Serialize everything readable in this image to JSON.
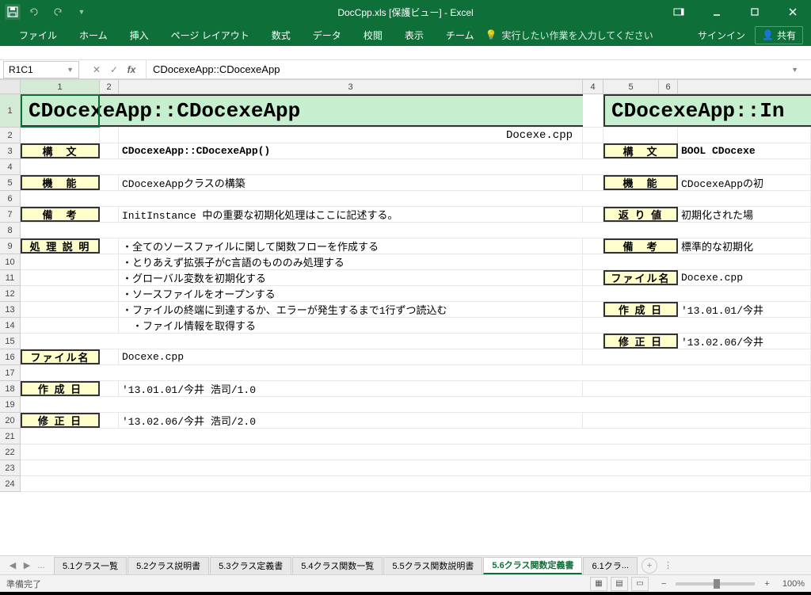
{
  "titlebar": {
    "title": "DocCpp.xls [保護ビュー] - Excel"
  },
  "ribbon": {
    "tabs": [
      "ファイル",
      "ホーム",
      "挿入",
      "ページ レイアウト",
      "数式",
      "データ",
      "校閲",
      "表示",
      "チーム"
    ],
    "tell_me": "実行したい作業を入力してください",
    "signin": "サインイン",
    "share": "共有"
  },
  "formula": {
    "name_box": "R1C1",
    "value": "CDocexeApp::CDocexeApp"
  },
  "columns": {
    "c1": "1",
    "c2": "2",
    "c3": "3",
    "c4": "4",
    "c5": "5",
    "c6": "6"
  },
  "rows": [
    "1",
    "2",
    "3",
    "4",
    "5",
    "6",
    "7",
    "8",
    "9",
    "10",
    "11",
    "12",
    "13",
    "14",
    "15",
    "16",
    "17",
    "18",
    "19",
    "20",
    "21",
    "22",
    "23",
    "24"
  ],
  "main": {
    "title": "CDocexeApp::CDocexeApp",
    "filename_top": "Docexe.cpp",
    "labels": {
      "syntax": "構　文",
      "function": "機　能",
      "remarks": "備　考",
      "process": "処 理 説 明",
      "filename": "ファイル名",
      "created": "作 成 日",
      "modified": "修 正 日"
    },
    "syntax": "CDocexeApp::CDocexeApp()",
    "functiontxt": "CDocexeAppクラスの構築",
    "remarks": "InitInstance 中の重要な初期化処理はここに記述する。",
    "process": [
      "・全てのソースファイルに関して関数フローを作成する",
      "・とりあえず拡張子がC言語のもののみ処理する",
      "・グローバル変数を初期化する",
      "・ソースファイルをオープンする",
      "・ファイルの終端に到達するか、エラーが発生するまで1行ずつ読込む",
      "　・ファイル情報を取得する"
    ],
    "filename": "Docexe.cpp",
    "created": "'13.01.01/今井 浩司/1.0",
    "modified": "'13.02.06/今井 浩司/2.0"
  },
  "side": {
    "title": "CDocexeApp::In",
    "labels": {
      "syntax": "構　文",
      "function": "機　能",
      "return": "返 り 値",
      "remarks": "備　考",
      "filename": "ファイル名",
      "created": "作 成 日",
      "modified": "修 正 日"
    },
    "syntax": "BOOL CDocexe",
    "functiontxt": "CDocexeAppの初",
    "returntxt": "初期化された場",
    "remarks": "標準的な初期化",
    "filename": "Docexe.cpp",
    "created": "'13.01.01/今井",
    "modified": "'13.02.06/今井"
  },
  "tabs": {
    "list": [
      "5.1クラス一覧",
      "5.2クラス説明書",
      "5.3クラス定義書",
      "5.4クラス関数一覧",
      "5.5クラス関数説明書",
      "5.6クラス関数定義書",
      "6.1クラ"
    ],
    "ellipsis": "..."
  },
  "status": {
    "ready": "準備完了",
    "zoom": "100%"
  }
}
